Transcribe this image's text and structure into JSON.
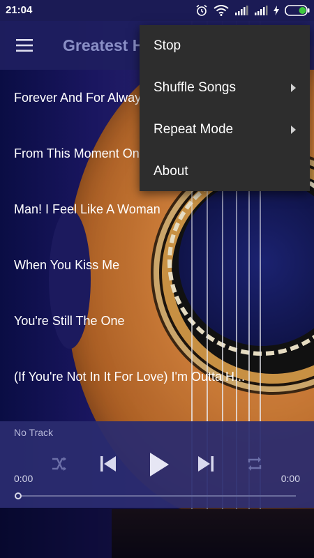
{
  "status_bar": {
    "time": "21:04",
    "icons": [
      "alarm-icon",
      "wifi-icon",
      "signal-icon",
      "signal-icon",
      "charging-icon",
      "battery-icon"
    ],
    "battery_color": "#3ec83e"
  },
  "app_bar": {
    "title": "Greatest H",
    "menu_icon": "hamburger-menu-icon"
  },
  "songs": [
    "Forever And For Always",
    "From This Moment On",
    "Man! I Feel Like A Woman",
    "When You Kiss Me",
    "You're Still The One",
    "(If You're Not In It For Love) I'm Outta H..."
  ],
  "overflow_menu": {
    "items": [
      {
        "label": "Stop",
        "has_submenu": false
      },
      {
        "label": "Shuffle Songs",
        "has_submenu": true
      },
      {
        "label": "Repeat Mode",
        "has_submenu": true
      },
      {
        "label": "About",
        "has_submenu": false
      }
    ]
  },
  "player": {
    "track": "No Track",
    "elapsed": "0:00",
    "total": "0:00",
    "progress": 0,
    "controls": [
      "shuffle-icon",
      "previous-icon",
      "play-icon",
      "next-icon",
      "repeat-icon"
    ]
  },
  "colors": {
    "status_bar_bg": "#1b1b55",
    "app_bar_bg": "#1e1e5f",
    "menu_bg": "#2d2d2d",
    "title_color": "#8a8fc6"
  }
}
